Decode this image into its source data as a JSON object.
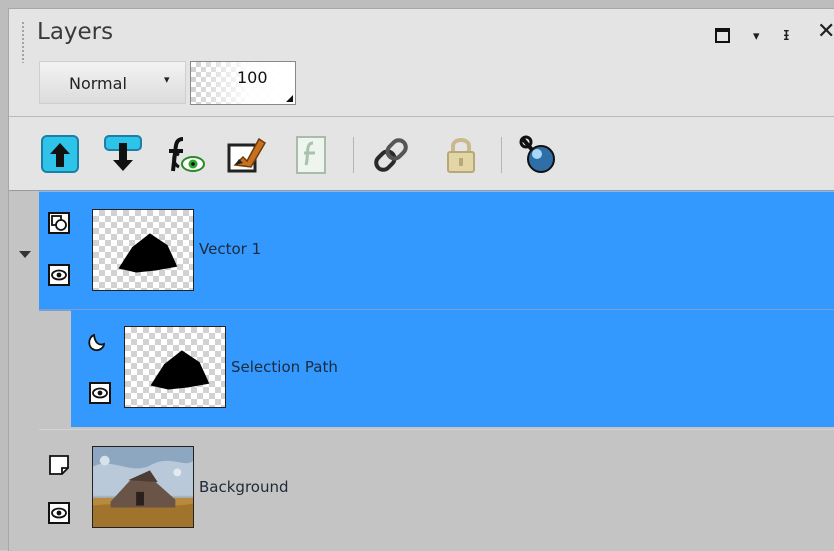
{
  "panel": {
    "title": "Layers",
    "controls": [
      "restore-icon",
      "menu-arrow-icon",
      "pin-icon",
      "close-icon"
    ],
    "close_glyph": "✕",
    "pin_glyph": "ᵻ",
    "menu_glyph": "▾"
  },
  "blend": {
    "value": "Normal",
    "arrow": "▾"
  },
  "opacity": {
    "value": "100"
  },
  "toolbar": {
    "buttons": [
      "move-layer-up-icon",
      "move-layer-down-icon",
      "layer-effects-icon",
      "edit-layer-icon",
      "mask-icon",
      "link-icon",
      "lock-icon",
      "layer-properties-icon"
    ]
  },
  "layers": [
    {
      "name": "Vector 1",
      "type_icon": "vector-layer-icon",
      "selected": true,
      "expanded": true
    },
    {
      "name": "Selection Path",
      "type_icon": "path-icon",
      "selected": true,
      "indent": 1
    },
    {
      "name": "Background",
      "type_icon": "raster-layer-icon",
      "selected": false
    }
  ],
  "colors": {
    "selection": "#3399ff",
    "panel": "#e4e4e4",
    "list": "#c4c4c4"
  }
}
